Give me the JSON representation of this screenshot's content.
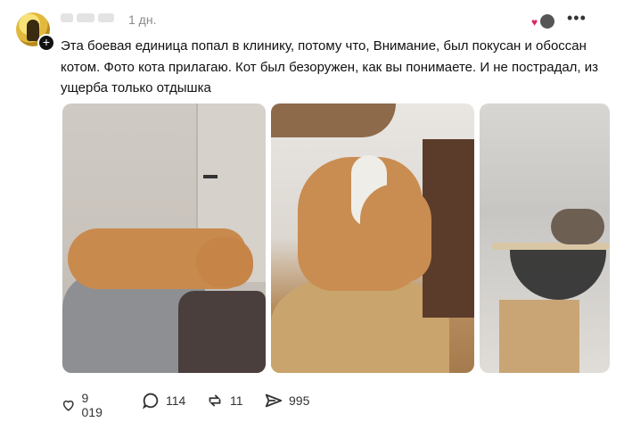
{
  "post": {
    "time": "1 дн.",
    "text": "Эта боевая единица попал в клинику, потому что, Внимание, был покусан и обоссан котом. Фото кота прилагаю. Кот был безоружен, как вы понимаете. И не пострадал, из ущерба только отдышка",
    "more_label": "•••",
    "plus_label": "+"
  },
  "actions": {
    "likes": "9 019",
    "comments": "114",
    "reposts": "11",
    "shares": "995"
  },
  "icons": {
    "like": "heart-icon",
    "comment": "comment-icon",
    "repost": "repost-icon",
    "share": "share-icon",
    "more": "more-icon"
  },
  "colors": {
    "text": "#111111",
    "secondary": "#8a8a8a",
    "accent": "#e0245e"
  }
}
